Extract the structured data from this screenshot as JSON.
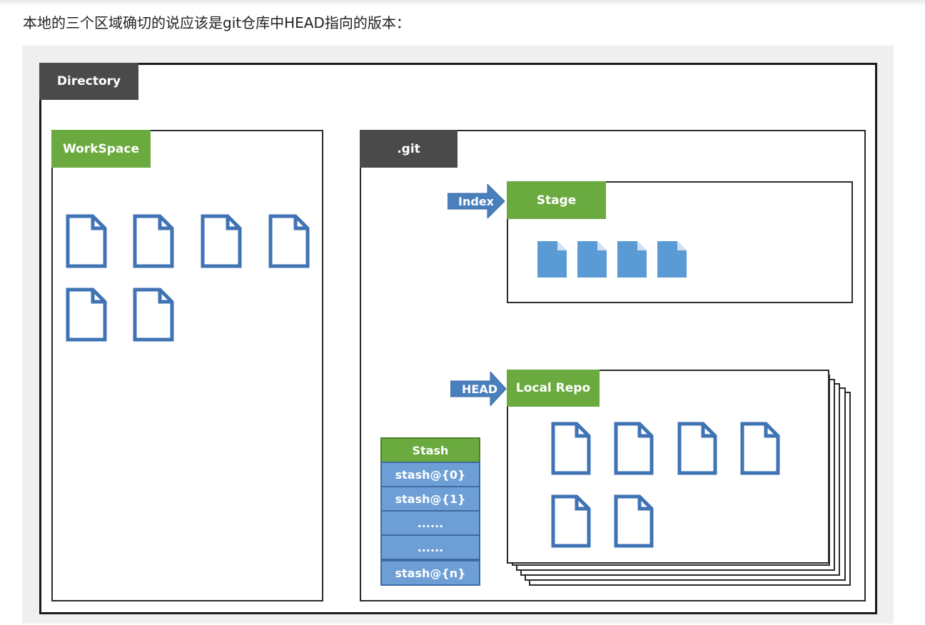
{
  "caption": "本地的三个区域确切的说应该是git仓库中HEAD指向的版本：",
  "diagram": {
    "directory_label": "Directory",
    "workspace_label": "WorkSpace",
    "git_label": ".git",
    "stage_label": "Stage",
    "index_arrow_label": "Index",
    "head_arrow_label": "HEAD",
    "local_repo_label": "Local Repo",
    "stash": {
      "header": "Stash",
      "entries": [
        "stash@{0}",
        "stash@{1}",
        "......",
        "......",
        "stash@{n}"
      ]
    }
  },
  "colors": {
    "green_label": "#6aaa3f",
    "dark_label": "#4a4a4a",
    "file_outline": "#3f73b4",
    "file_fill": "#5b9bd5",
    "arrow": "#4a7fbd",
    "stash_row": "#6d9fd6"
  },
  "icons": {
    "outline_file": "document-outline-icon",
    "filled_file": "document-filled-icon",
    "arrow": "right-arrow-icon"
  }
}
